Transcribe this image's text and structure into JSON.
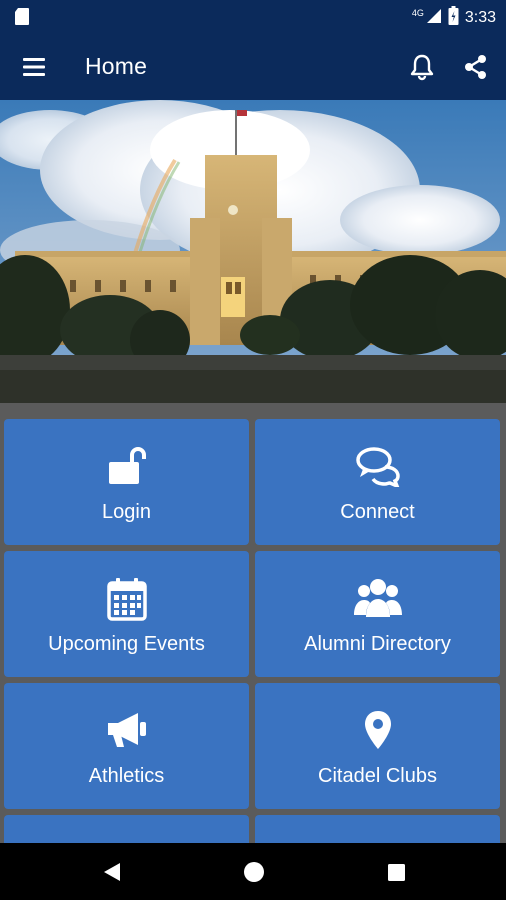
{
  "status_bar": {
    "time": "3:33",
    "network": "4G",
    "icons": [
      "sd-card-icon",
      "signal-icon",
      "battery-icon"
    ]
  },
  "app_bar": {
    "title": "Home",
    "icons": [
      "menu-icon",
      "bell-icon",
      "share-icon"
    ]
  },
  "hero": {
    "alt": "Citadel campus barracks tower with rainbow"
  },
  "tiles": [
    {
      "label": "Login",
      "icon": "unlock-icon"
    },
    {
      "label": "Connect",
      "icon": "chat-bubbles-icon"
    },
    {
      "label": "Upcoming Events",
      "icon": "calendar-icon"
    },
    {
      "label": "Alumni Directory",
      "icon": "group-icon"
    },
    {
      "label": "Athletics",
      "icon": "megaphone-icon"
    },
    {
      "label": "Citadel Clubs",
      "icon": "map-pin-icon"
    }
  ],
  "colors": {
    "app_bar": "#0b2a5b",
    "tile": "#3a73c1",
    "background": "#5b5b5b"
  },
  "nav_bar": {
    "icons": [
      "back-icon",
      "home-icon",
      "recents-icon"
    ]
  }
}
